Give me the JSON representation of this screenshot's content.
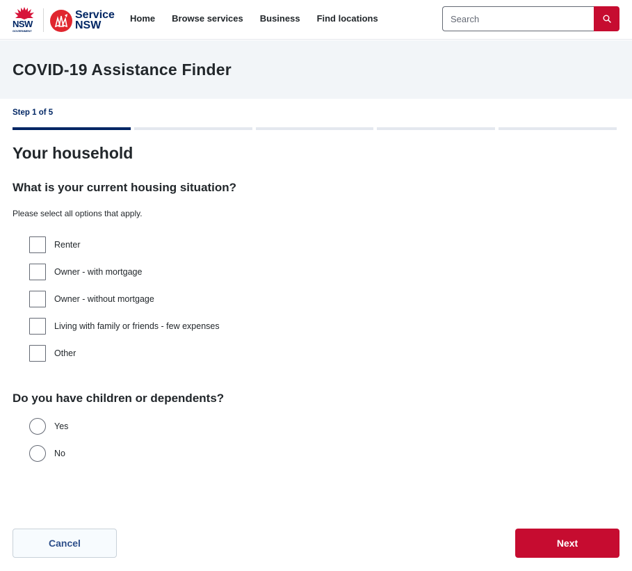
{
  "header": {
    "nsw_logo": {
      "wordmark": "NSW",
      "subtext": "GOVERNMENT",
      "icon": "waratah-icon"
    },
    "service_logo": {
      "line1": "Service",
      "line2": "NSW",
      "icon": "service-nsw-icon"
    },
    "nav": [
      {
        "label": "Home"
      },
      {
        "label": "Browse services"
      },
      {
        "label": "Business"
      },
      {
        "label": "Find locations"
      }
    ],
    "search": {
      "placeholder": "Search",
      "value": "",
      "button_icon": "search-icon"
    }
  },
  "page": {
    "title": "COVID-19 Assistance Finder"
  },
  "stepper": {
    "label": "Step 1 of 5",
    "current": 1,
    "total": 5
  },
  "form": {
    "section_title": "Your household",
    "housing": {
      "question": "What is your current housing situation?",
      "hint": "Please select all options that apply.",
      "options": [
        {
          "label": "Renter",
          "checked": false
        },
        {
          "label": "Owner - with mortgage",
          "checked": false
        },
        {
          "label": "Owner - without mortgage",
          "checked": false
        },
        {
          "label": "Living with family or friends - few expenses",
          "checked": false
        },
        {
          "label": "Other",
          "checked": false
        }
      ]
    },
    "dependents": {
      "question": "Do you have children or dependents?",
      "options": [
        {
          "label": "Yes",
          "selected": false
        },
        {
          "label": "No",
          "selected": false
        }
      ]
    }
  },
  "actions": {
    "cancel_label": "Cancel",
    "next_label": "Next"
  },
  "colors": {
    "brand_red": "#c60c30",
    "navy": "#002664",
    "title_band": "#f2f5f8"
  }
}
